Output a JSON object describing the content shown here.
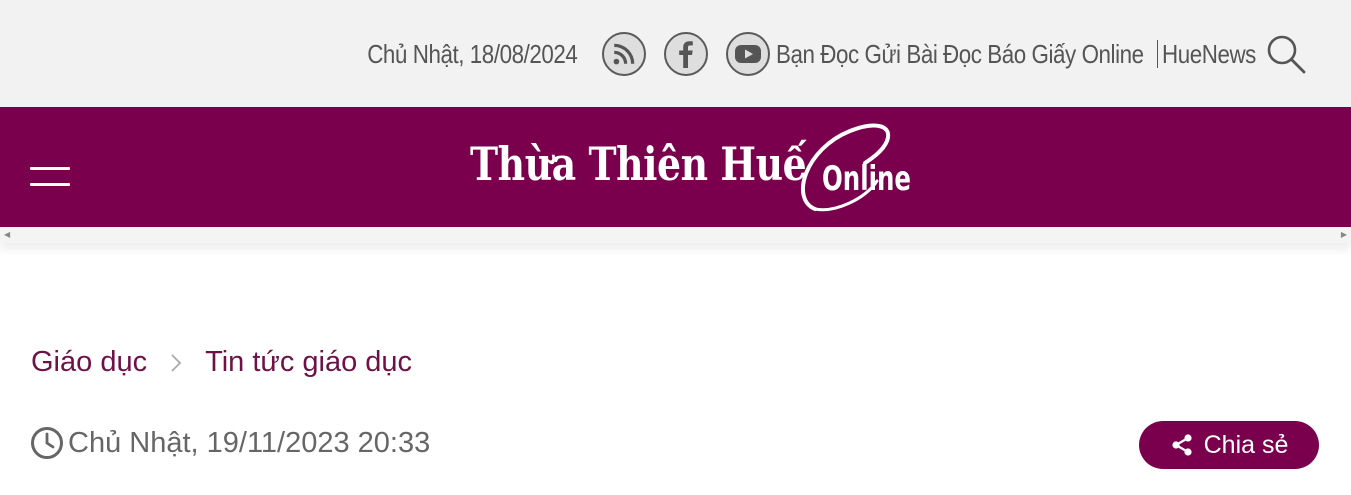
{
  "topbar": {
    "date": "Chủ Nhật, 18/08/2024",
    "links": {
      "reader_submit": "Bạn Đọc Gửi Bài",
      "print_online": "Đọc Báo Giấy Online",
      "huenews": "HueNews"
    },
    "icons": [
      "rss-icon",
      "facebook-icon",
      "youtube-icon",
      "search-icon"
    ]
  },
  "banner": {
    "logo_main": "Thừa Thiên Huế",
    "logo_suffix": "Online",
    "background_color": "#7a004e"
  },
  "breadcrumb": {
    "items": [
      "Giáo dục",
      "Tin tức giáo dục"
    ]
  },
  "article": {
    "date": "Chủ Nhật, 19/11/2023 20:33",
    "share_label": "Chia sẻ"
  },
  "colors": {
    "brand": "#7a004e",
    "breadcrumb_text": "#6e1147",
    "muted_text": "#666666",
    "topbar_bg": "#f2f2f2"
  }
}
